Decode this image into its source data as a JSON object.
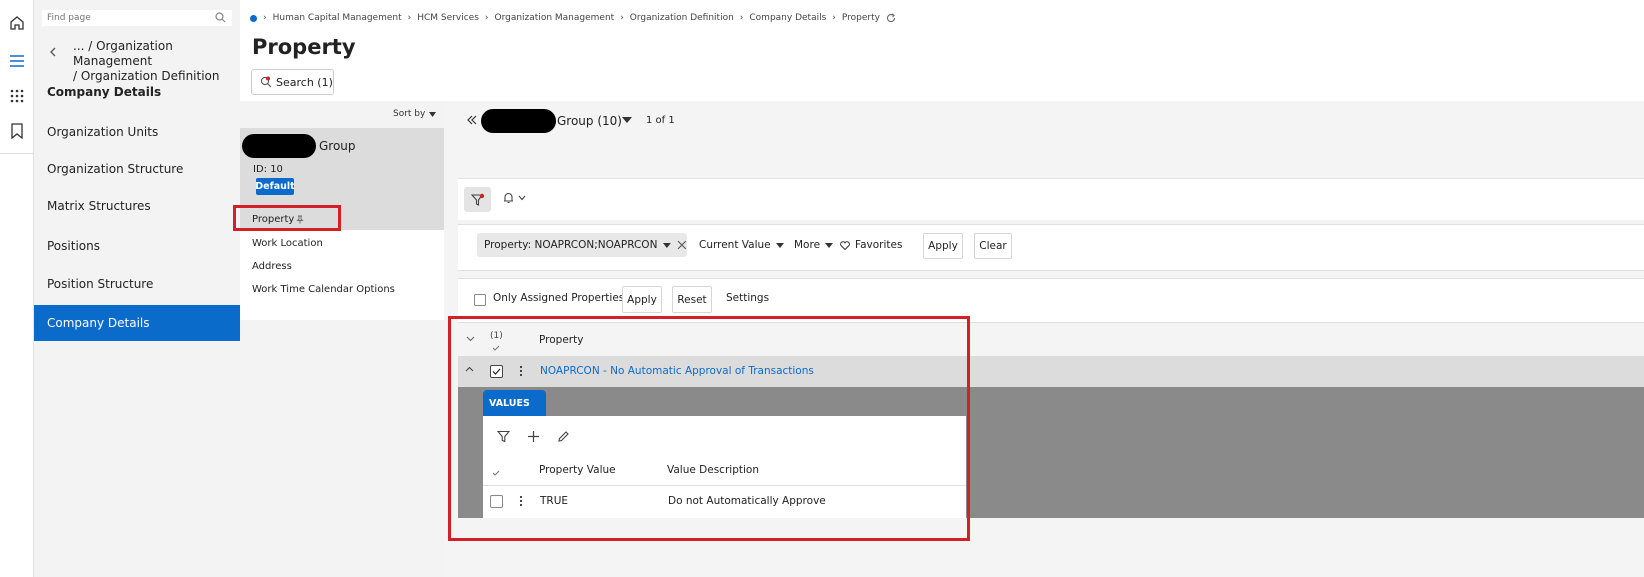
{
  "search": {
    "placeholder": "Find page"
  },
  "navigator": {
    "path_line1": "... / Organization Management",
    "path_line2": "/ Organization Definition",
    "heading": "Company Details",
    "items": [
      {
        "label": "Organization Units"
      },
      {
        "label": "Organization Structure"
      },
      {
        "label": "Matrix Structures"
      },
      {
        "label": "Positions"
      },
      {
        "label": "Position Structure"
      },
      {
        "label": "Company Details",
        "active": true
      }
    ]
  },
  "breadcrumb": [
    "Human Capital Management",
    "HCM Services",
    "Organization Management",
    "Organization Definition",
    "Company Details",
    "Property"
  ],
  "page": {
    "title": "Property",
    "search_button": "Search (1)"
  },
  "list_panel": {
    "sort_label": "Sort by",
    "record_name": "Group",
    "record_id": "ID:  10",
    "default_badge": "Default",
    "sub_items": [
      "Property",
      "Work Location",
      "Address",
      "Work Time Calendar Options"
    ]
  },
  "record_header": {
    "name": "Group (10)",
    "pager": "1 of 1"
  },
  "filter_bar": {
    "property_filter": "Property: NOAPRCON;NOAPRCON",
    "current_value": "Current Value",
    "more": "More",
    "favorites": "Favorites",
    "apply": "Apply",
    "clear": "Clear"
  },
  "options_bar": {
    "only_assigned": "Only Assigned Properties",
    "apply": "Apply",
    "reset": "Reset",
    "settings": "Settings"
  },
  "grid": {
    "count": "(1)",
    "column": "Property",
    "row_link": "NOAPRCON - No Automatic Approval of Transactions"
  },
  "values_tab": {
    "tab_label": "VALUES",
    "columns": [
      "Property Value",
      "Value Description"
    ],
    "rows": [
      {
        "value": "TRUE",
        "description": "Do not Automatically Approve"
      }
    ]
  },
  "colors": {
    "accent": "#0b6bcb",
    "highlight": "#d32027",
    "header_gray": "#888888"
  }
}
